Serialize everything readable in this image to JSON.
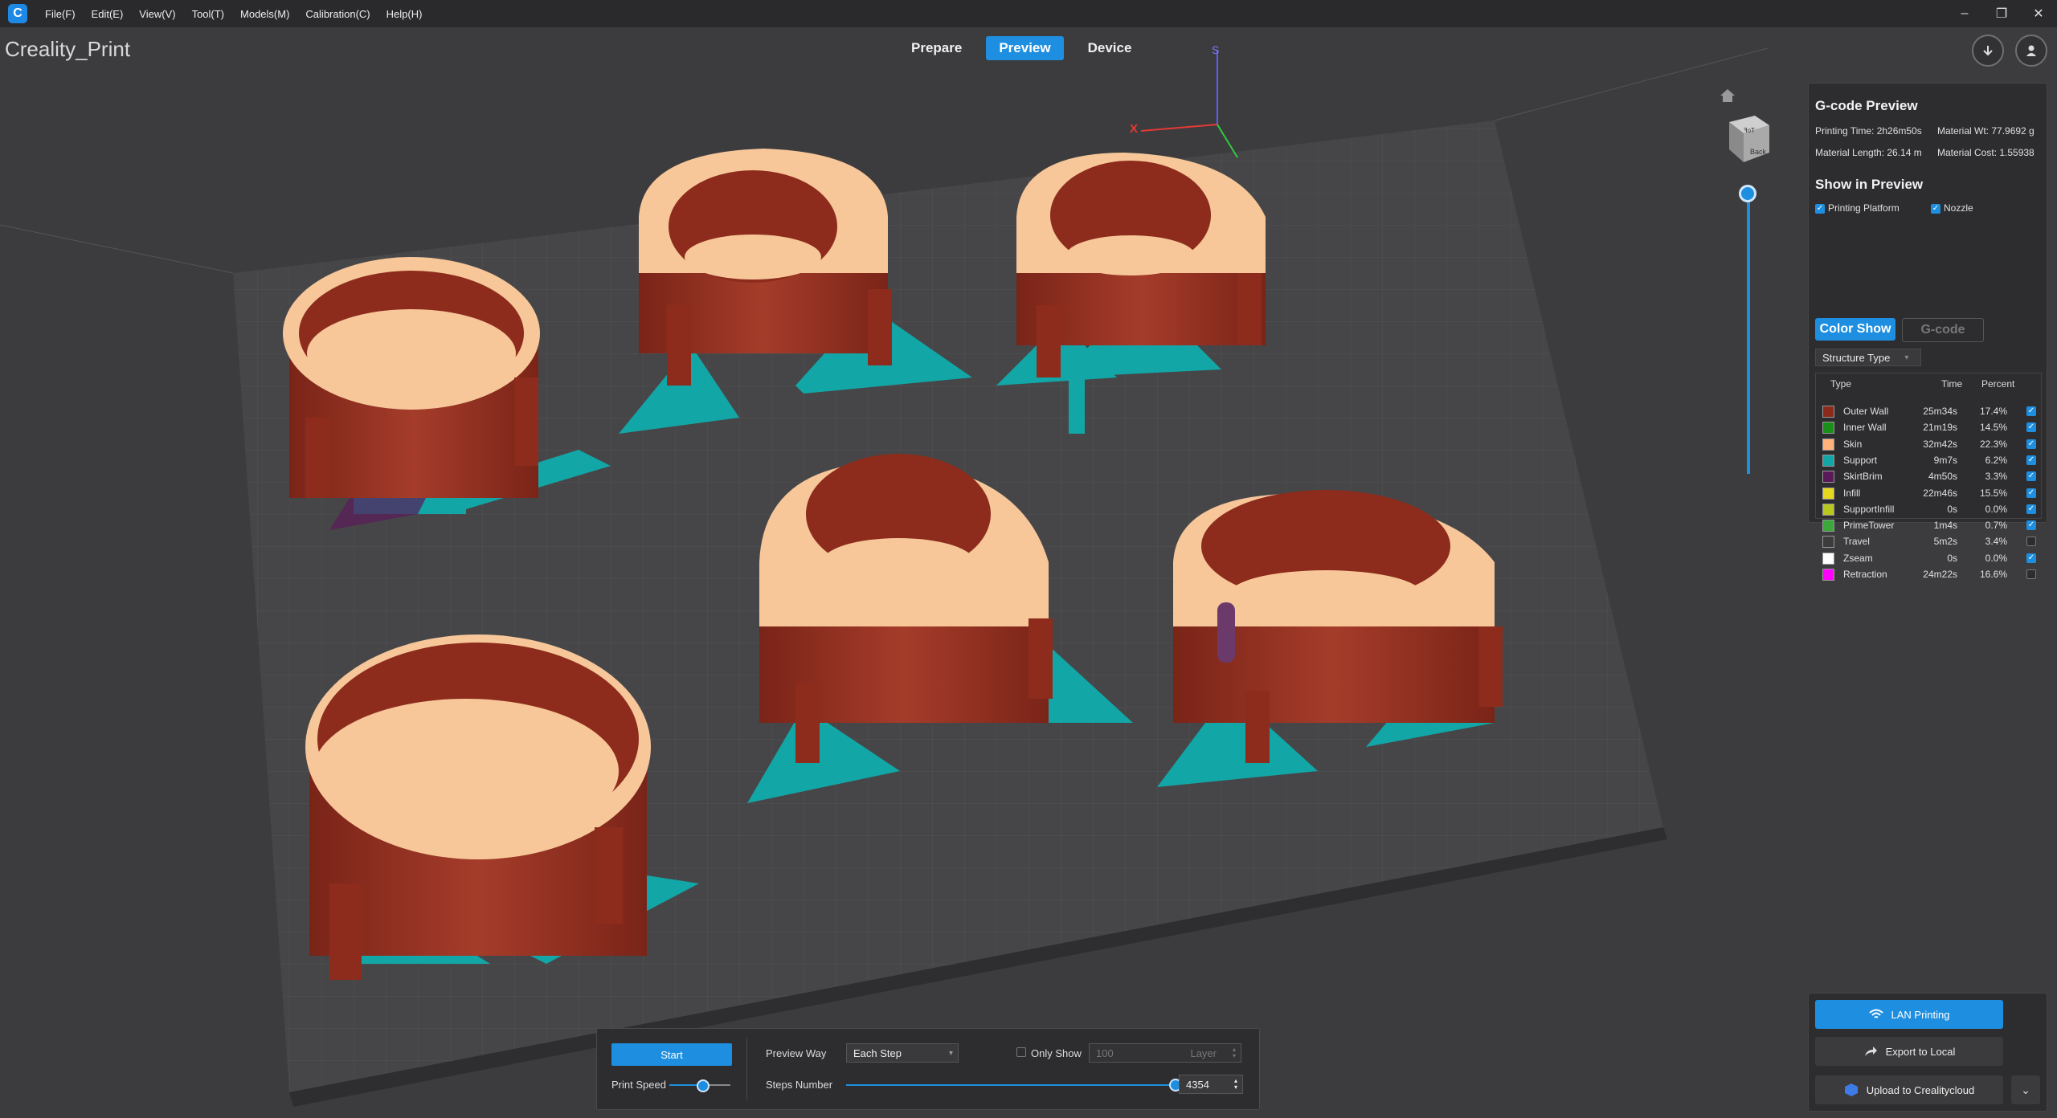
{
  "menubar": {
    "logo": "C",
    "items": [
      "File(F)",
      "Edit(E)",
      "View(V)",
      "Tool(T)",
      "Models(M)",
      "Calibration(C)",
      "Help(H)"
    ],
    "window_controls": [
      "–",
      "❐",
      "✕"
    ]
  },
  "app_title": "Creality_Print",
  "tabs": {
    "prepare": "Prepare",
    "preview": "Preview",
    "device": "Device",
    "active": "Preview"
  },
  "top_buttons": {
    "download_icon": "download-icon",
    "user_icon": "user-icon"
  },
  "gcode_preview": {
    "title": "G-code Preview",
    "printing_time": "Printing Time: 2h26m50s",
    "material_wt": "Material Wt: 77.9692 g",
    "material_length": "Material Length: 26.14 m",
    "material_cost": "Material Cost: 1.55938",
    "show_title": "Show in Preview",
    "printing_platform": "Printing Platform",
    "nozzle": "Nozzle",
    "color_show": "Color Show",
    "gcode": "G-code",
    "structure_type": "Structure Type",
    "col_type": "Type",
    "col_time": "Time",
    "col_percent": "Percent",
    "rows": [
      {
        "name": "Outer Wall",
        "time": "25m34s",
        "percent": "17.4%",
        "color": "#8b2a1a",
        "checked": true
      },
      {
        "name": "Inner Wall",
        "time": "21m19s",
        "percent": "14.5%",
        "color": "#1a8f1a",
        "checked": true
      },
      {
        "name": "Skin",
        "time": "32m42s",
        "percent": "22.3%",
        "color": "#ffb27a",
        "checked": true
      },
      {
        "name": "Support",
        "time": "9m7s",
        "percent": "6.2%",
        "color": "#13a6a6",
        "checked": true
      },
      {
        "name": "SkirtBrim",
        "time": "4m50s",
        "percent": "3.3%",
        "color": "#5a1a5a",
        "checked": true
      },
      {
        "name": "Infill",
        "time": "22m46s",
        "percent": "15.5%",
        "color": "#e6d81e",
        "checked": true
      },
      {
        "name": "SupportInfill",
        "time": "0s",
        "percent": "0.0%",
        "color": "#b8c81e",
        "checked": true
      },
      {
        "name": "PrimeTower",
        "time": "1m4s",
        "percent": "0.7%",
        "color": "#3aa83a",
        "checked": true
      },
      {
        "name": "Travel",
        "time": "5m2s",
        "percent": "3.4%",
        "color": "#3c3c3c",
        "checked": false
      },
      {
        "name": "Zseam",
        "time": "0s",
        "percent": "0.0%",
        "color": "#ffffff",
        "checked": true
      },
      {
        "name": "Retraction",
        "time": "24m22s",
        "percent": "16.6%",
        "color": "#ff00ff",
        "checked": false
      }
    ]
  },
  "right_buttons": {
    "lan": "LAN Printing",
    "export": "Export to Local",
    "upload": "Upload to Crealitycloud"
  },
  "bottom": {
    "start": "Start",
    "print_speed": "Print Speed",
    "print_speed_level": 0.55,
    "preview_way_label": "Preview Way",
    "preview_way_value": "Each Step",
    "only_show": "Only Show",
    "only_show_value": "100",
    "layer": "Layer",
    "steps_number_label": "Steps Number",
    "steps_value": "4354",
    "steps_level": 1.0
  },
  "viewcube": {
    "top": "ꟻoT",
    "face": "Back"
  },
  "axes": {
    "x": "X",
    "z": "S"
  },
  "layer_slider_level": 1.0
}
